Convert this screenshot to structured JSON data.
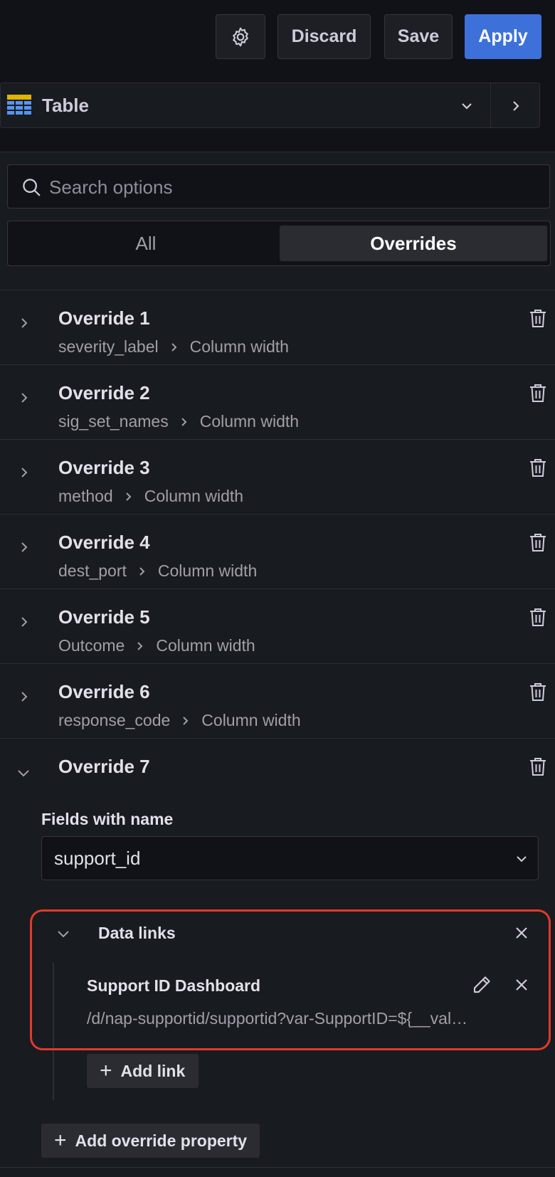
{
  "toolbar": {
    "discard_label": "Discard",
    "save_label": "Save",
    "apply_label": "Apply",
    "apply_color": "#3d71d9"
  },
  "visualization": {
    "label": "Table",
    "icon": "table-icon"
  },
  "search": {
    "placeholder": "Search options"
  },
  "tabs": [
    {
      "label": "All",
      "active": false
    },
    {
      "label": "Overrides",
      "active": true
    }
  ],
  "overrides": [
    {
      "title": "Override 1",
      "field": "severity_label",
      "property": "Column width"
    },
    {
      "title": "Override 2",
      "field": "sig_set_names",
      "property": "Column width"
    },
    {
      "title": "Override 3",
      "field": "method",
      "property": "Column width"
    },
    {
      "title": "Override 4",
      "field": "dest_port",
      "property": "Column width"
    },
    {
      "title": "Override 5",
      "field": "Outcome",
      "property": "Column width"
    },
    {
      "title": "Override 6",
      "field": "response_code",
      "property": "Column width"
    },
    {
      "title": "Override 7",
      "expanded": true
    }
  ],
  "expanded_override": {
    "matcher_label": "Fields with name",
    "matcher_value": "support_id",
    "data_links": {
      "title": "Data links",
      "link_title": "Support ID Dashboard",
      "link_url": "/d/nap-supportid/supportid?var-SupportID=${__val…",
      "add_link_label": "Add link"
    },
    "add_property_label": "Add override property"
  },
  "colors": {
    "highlight": "#e03a2b",
    "background": "#181b1f"
  }
}
